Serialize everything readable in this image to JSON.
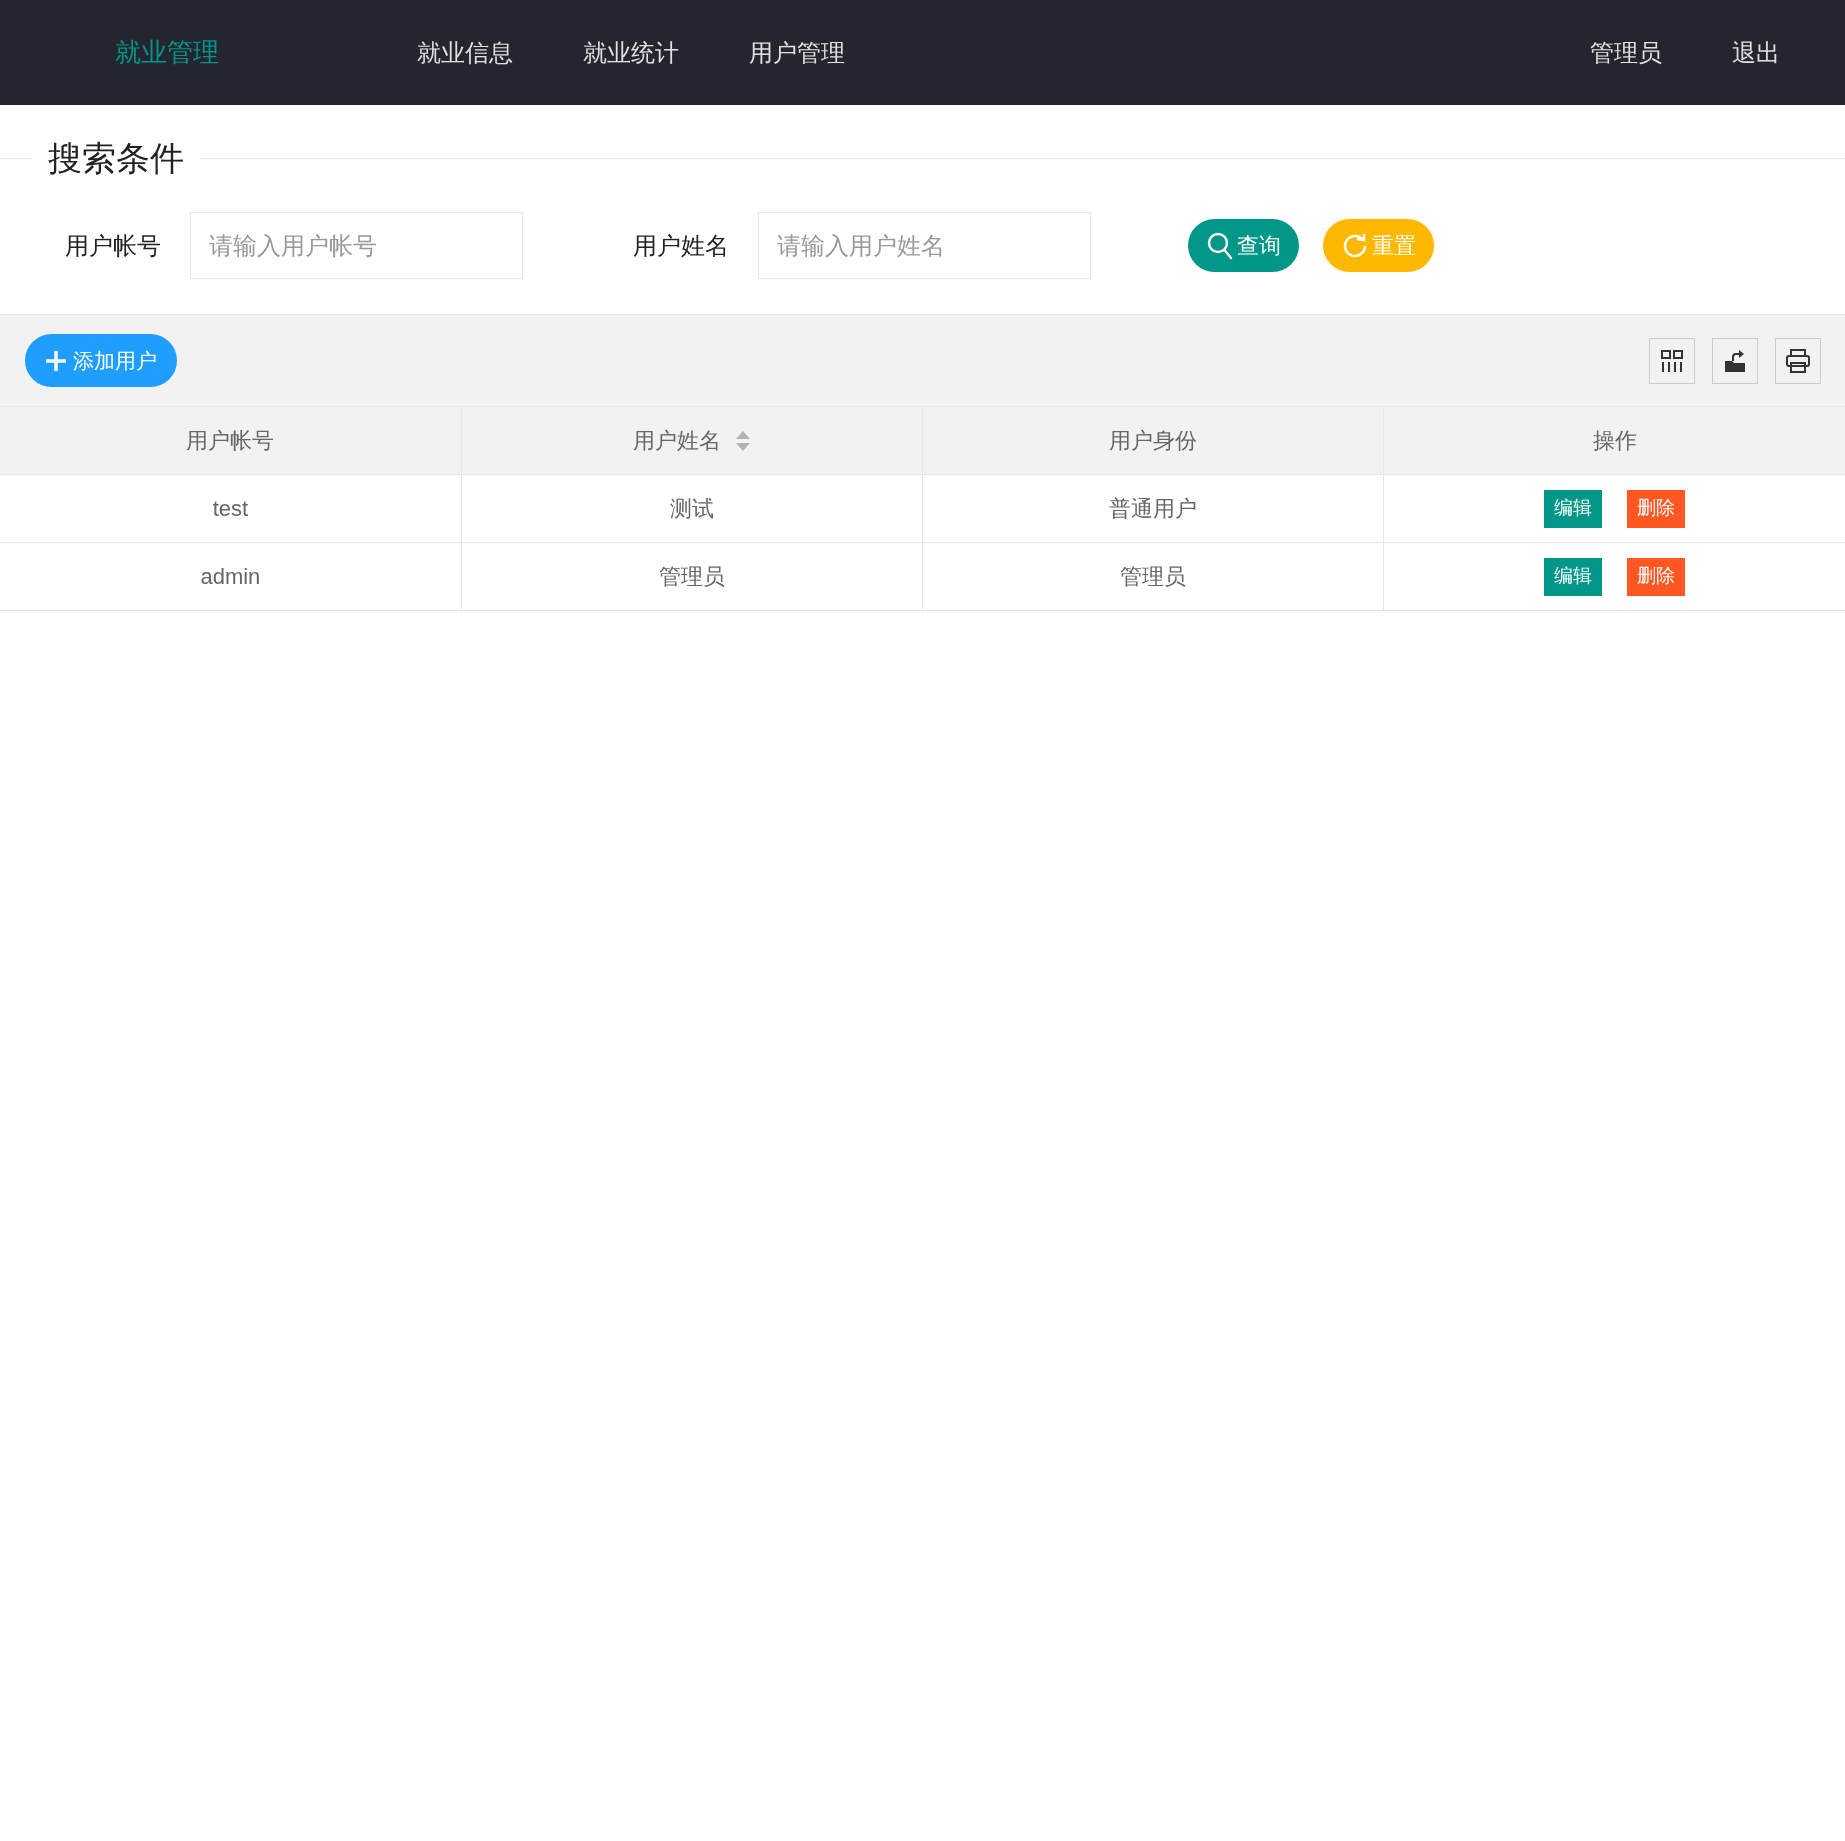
{
  "header": {
    "logo": "就业管理",
    "nav": [
      {
        "label": "就业信息"
      },
      {
        "label": "就业统计"
      },
      {
        "label": "用户管理"
      }
    ],
    "user_menu": [
      {
        "label": "管理员"
      },
      {
        "label": "退出"
      }
    ]
  },
  "search": {
    "legend": "搜索条件",
    "fields": [
      {
        "label": "用户帐号",
        "placeholder": "请输入用户帐号"
      },
      {
        "label": "用户姓名",
        "placeholder": "请输入用户姓名"
      }
    ],
    "buttons": [
      {
        "kind": "search",
        "label": "查询"
      },
      {
        "kind": "reset",
        "label": "重置"
      }
    ]
  },
  "toolbar": {
    "add_button": "添加用户"
  },
  "table": {
    "columns": [
      {
        "label": "用户帐号",
        "sortable": false
      },
      {
        "label": "用户姓名",
        "sortable": true
      },
      {
        "label": "用户身份",
        "sortable": false
      },
      {
        "label": "操作",
        "sortable": false
      }
    ],
    "rows": [
      {
        "cells": [
          "test",
          "测试",
          "普通用户"
        ],
        "actions": [
          "编辑",
          "删除"
        ]
      },
      {
        "cells": [
          "admin",
          "管理员",
          "管理员"
        ],
        "actions": [
          "编辑",
          "删除"
        ]
      }
    ]
  }
}
